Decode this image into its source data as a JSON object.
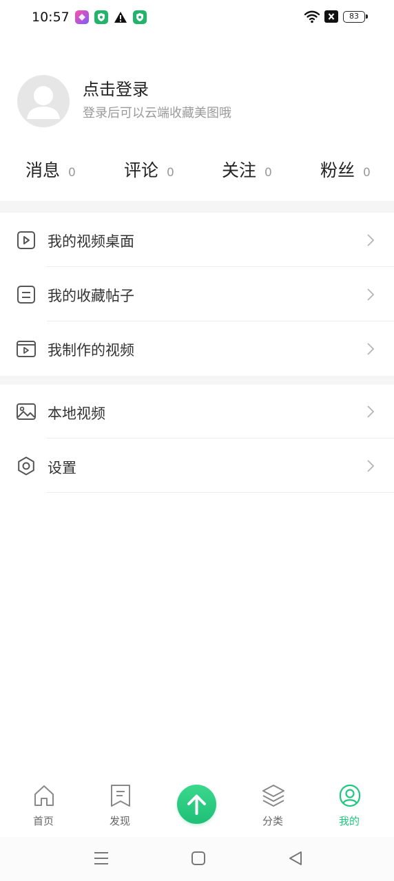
{
  "status_bar": {
    "time": "10:57",
    "battery": "83",
    "notification_icons": [
      "app-icon-pink",
      "shield-icon-green",
      "warning-icon",
      "shield-icon-green"
    ],
    "system_icons": [
      "wifi-icon",
      "close-box-icon",
      "battery-icon"
    ]
  },
  "profile": {
    "title": "点击登录",
    "subtitle": "登录后可以云端收藏美图哦"
  },
  "stats": [
    {
      "label": "消息",
      "count": "0"
    },
    {
      "label": "评论",
      "count": "0"
    },
    {
      "label": "关注",
      "count": "0"
    },
    {
      "label": "粉丝",
      "count": "0"
    }
  ],
  "menu": [
    {
      "label": "我的视频桌面",
      "icon": "video-desktop-icon"
    },
    {
      "label": "我的收藏帖子",
      "icon": "document-icon"
    },
    {
      "label": "我制作的视频",
      "icon": "video-player-icon"
    },
    {
      "label": "本地视频",
      "icon": "image-icon"
    },
    {
      "label": "设置",
      "icon": "gear-icon"
    }
  ],
  "bottom_nav": [
    {
      "label": "首页",
      "icon": "home-icon"
    },
    {
      "label": "发现",
      "icon": "bookmark-icon"
    },
    {
      "label": "",
      "icon": "upload-arrow-icon"
    },
    {
      "label": "分类",
      "icon": "layers-icon"
    },
    {
      "label": "我的",
      "icon": "user-icon",
      "active": true
    }
  ],
  "colors": {
    "accent": "#1fc77e",
    "text_primary": "#222222",
    "text_secondary": "#9a9a9a",
    "divider": "#ebebeb",
    "section_gap": "#f5f5f5"
  }
}
